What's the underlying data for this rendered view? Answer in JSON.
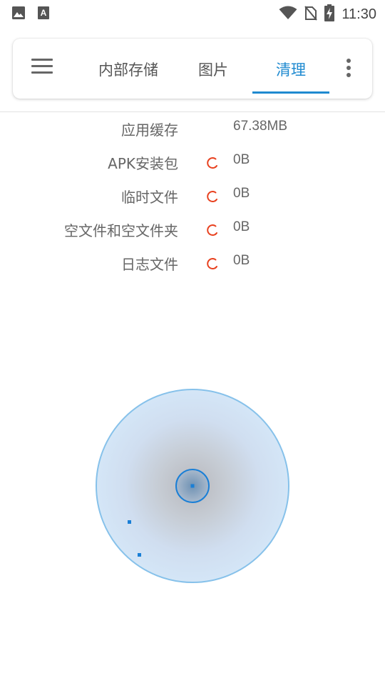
{
  "status_bar": {
    "time": "11:30",
    "left_icons": [
      "image-icon",
      "font-a-icon"
    ],
    "right_icons": [
      "wifi-icon",
      "no-sim-icon",
      "battery-charging-icon"
    ]
  },
  "app_bar": {
    "tabs": [
      {
        "label": "内部存储",
        "active": false
      },
      {
        "label": "图片",
        "active": false
      },
      {
        "label": "清理",
        "active": true
      }
    ],
    "accent_color": "#1f8ad0"
  },
  "clean_items": [
    {
      "label": "应用缓存",
      "value": "67.38MB",
      "loading": false
    },
    {
      "label": "APK安装包",
      "value": "0B",
      "loading": true
    },
    {
      "label": "临时文件",
      "value": "0B",
      "loading": true
    },
    {
      "label": "空文件和空文件夹",
      "value": "0B",
      "loading": true
    },
    {
      "label": "日志文件",
      "value": "0B",
      "loading": true
    }
  ],
  "scanner": {
    "state": "scanning",
    "colors": {
      "fill": "#d4e6f7",
      "ring": "#86c1ea",
      "dot": "#1a7fd6"
    }
  }
}
